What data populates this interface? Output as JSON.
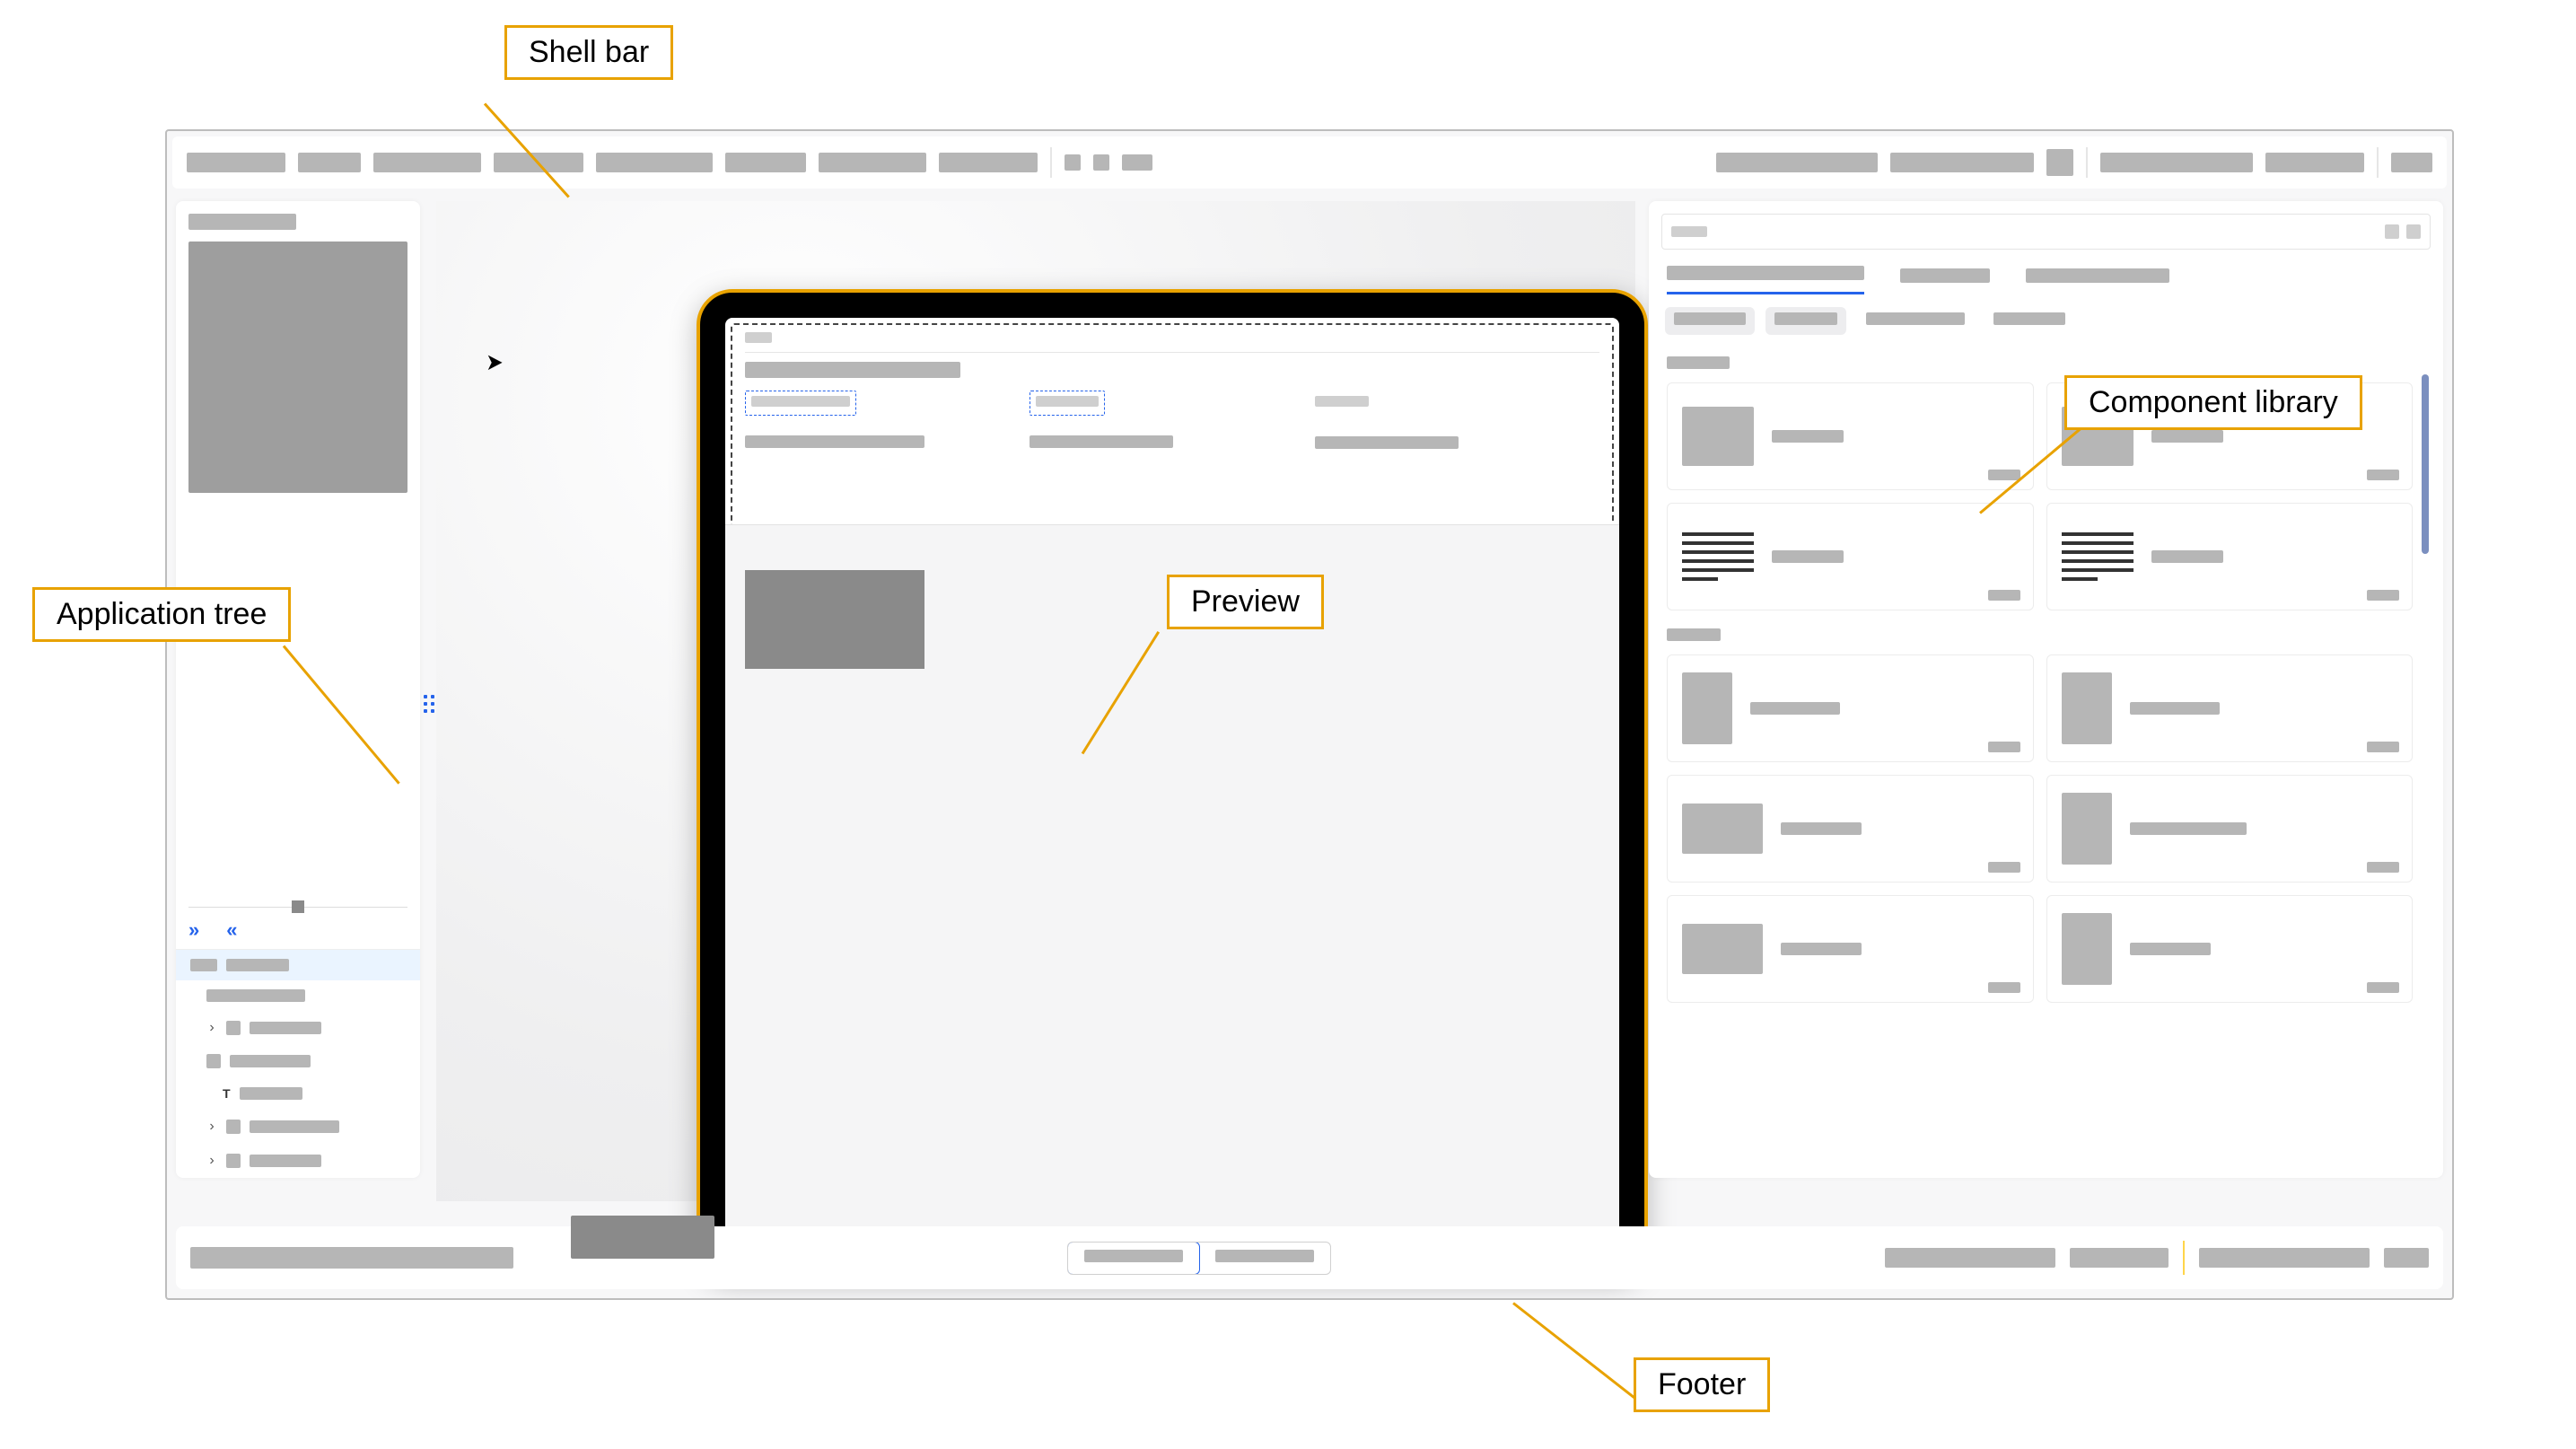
{
  "annotations": {
    "shell_bar": "Shell bar",
    "application_tree": "Application tree",
    "preview": "Preview",
    "component_library": "Component library",
    "footer": "Footer"
  },
  "shellbar": {
    "items_left": [
      "▢▢▢▢▢",
      "▢▢▢",
      "▢▢▢▢▢",
      "▢▢▢▢",
      "▢▢▢▢▢▢",
      "▢▢▢▢",
      "▢▢▢▢▢",
      "▢▢▢▢▢"
    ],
    "items_right": [
      "▢▢▢▢▢▢▢▢",
      "▢▢▢▢▢▢",
      "▢▢",
      "▢▢▢▢▢▢▢▢",
      "▢▢▢▢▢▢",
      "▢▢"
    ]
  },
  "left_panel": {
    "title": "▢▢▢▢▢▢",
    "expand_all_icon": "⌄⌄",
    "collapse_all_icon": "⌃⌃",
    "tree": {
      "root_a": "▢▢",
      "root_b": "▢▢▢▢",
      "node1": "▢▢▢▢▢▢▢",
      "node2": "▢▢▢▢▢",
      "node3": "▢▢▢▢▢▢",
      "node4": "▢▢▢▢",
      "node5": "▢▢▢▢▢▢▢",
      "node6": "▢▢▢▢▢"
    }
  },
  "preview": {
    "breadcrumb": "▢▢",
    "title": "▢▢▢▢▢▢▢▢▢▢",
    "col1_label": "▢▢▢▢▢",
    "col1_value": "▢▢▢▢▢▢▢▢▢",
    "col2_label": "▢▢▢",
    "col2_value": "▢▢▢▢▢▢▢",
    "col3_label": "▢▢▢",
    "col3_value": "▢▢▢▢▢▢▢"
  },
  "right_panel": {
    "search_placeholder": "",
    "tabs": [
      "▢▢▢▢▢▢▢▢▢",
      "▢▢▢▢▢",
      "▢▢▢▢▢▢▢"
    ],
    "chips": [
      "▢▢▢▢▢",
      "▢▢▢▢",
      "▢▢▢▢▢▢",
      "▢▢▢▢"
    ],
    "section1_title": "▢▢▢▢",
    "section2_title": "▢▢▢",
    "card_label": "▢▢▢▢",
    "card_corner": "▢▢"
  },
  "footer": {
    "status_left": "▢▢▢▢▢▢▢▢▢▢▢▢▢",
    "seg_a": "▢▢▢▢▢▢",
    "seg_b": "▢▢▢▢▢▢",
    "items_right": [
      "▢▢▢▢▢▢▢▢",
      "▢▢▢▢▢",
      "▢▢▢▢▢▢▢▢",
      "▢▢"
    ]
  }
}
